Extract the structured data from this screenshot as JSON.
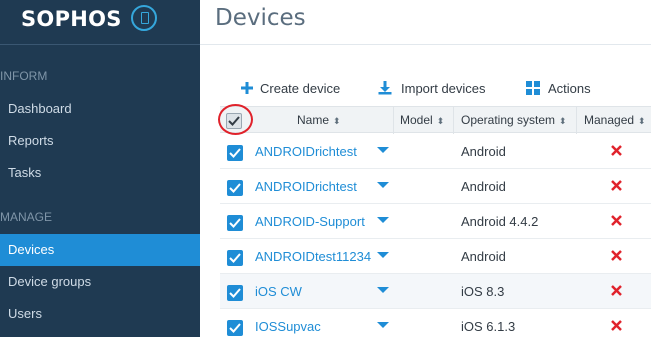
{
  "brand": {
    "name": "SOPHOS",
    "accent": "#35a7dc",
    "sidebar_bg": "#1f3a52",
    "active_bg": "#1f8dd6"
  },
  "sidebar": {
    "sections": [
      {
        "label": "INFORM",
        "items": [
          "Dashboard",
          "Reports",
          "Tasks"
        ]
      },
      {
        "label": "MANAGE",
        "items": [
          "Devices",
          "Device groups",
          "Users"
        ]
      }
    ],
    "active_item": "Devices"
  },
  "page": {
    "title": "Devices"
  },
  "toolbar": {
    "create_label": "Create device",
    "import_label": "Import devices",
    "actions_label": "Actions"
  },
  "table": {
    "columns": {
      "name": "Name",
      "model": "Model",
      "os": "Operating system",
      "managed": "Managed"
    },
    "select_all_checked": true,
    "rows": [
      {
        "name": "ANDROIDrichtest",
        "os": "Android",
        "managed": false,
        "checked": true
      },
      {
        "name": "ANDROIDrichtest",
        "os": "Android",
        "managed": false,
        "checked": true
      },
      {
        "name": "ANDROID-Support",
        "os": "Android 4.4.2",
        "managed": false,
        "checked": true
      },
      {
        "name": "ANDROIDtest11234",
        "os": "Android",
        "managed": false,
        "checked": true
      },
      {
        "name": "iOS CW",
        "os": "iOS 8.3",
        "managed": false,
        "checked": true
      },
      {
        "name": "IOSSupvac",
        "os": "iOS 6.1.3",
        "managed": false,
        "checked": true
      }
    ]
  }
}
